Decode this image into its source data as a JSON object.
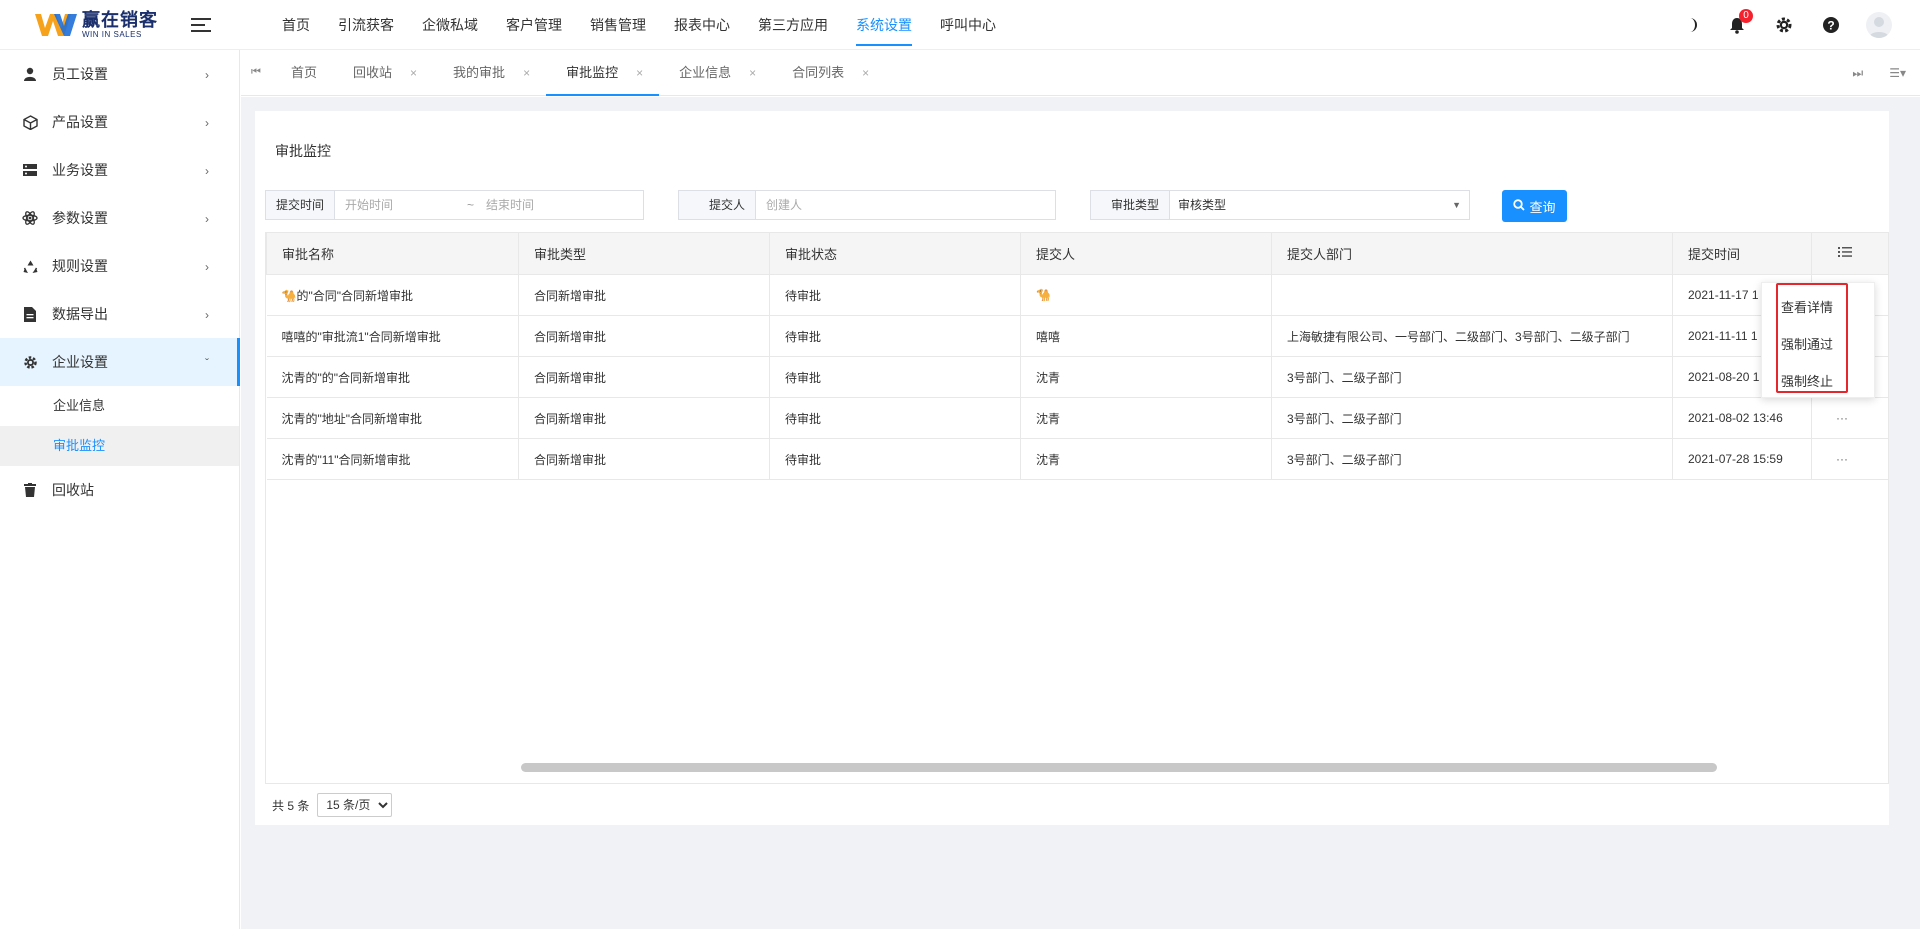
{
  "app": {
    "logo_cn": "赢在销客",
    "logo_en": "WIN IN SALES",
    "brand_color": "#1890ff"
  },
  "topnav": [
    {
      "label": "首页"
    },
    {
      "label": "引流获客"
    },
    {
      "label": "企微私域"
    },
    {
      "label": "客户管理"
    },
    {
      "label": "销售管理"
    },
    {
      "label": "报表中心"
    },
    {
      "label": "第三方应用"
    },
    {
      "label": "系统设置",
      "active": true
    },
    {
      "label": "呼叫中心"
    }
  ],
  "header_right": {
    "notification_count": "0",
    "icons": [
      "moon-icon",
      "bell-icon",
      "gear-icon",
      "help-icon",
      "avatar"
    ]
  },
  "sidebar": {
    "items": [
      {
        "label": "员工设置",
        "icon": "user-icon"
      },
      {
        "label": "产品设置",
        "icon": "box-icon"
      },
      {
        "label": "业务设置",
        "icon": "server-icon"
      },
      {
        "label": "参数设置",
        "icon": "atom-icon"
      },
      {
        "label": "规则设置",
        "icon": "recycle-icon"
      },
      {
        "label": "数据导出",
        "icon": "file-icon"
      },
      {
        "label": "企业设置",
        "icon": "gear-icon"
      },
      {
        "label": "回收站",
        "icon": "trash-icon"
      }
    ],
    "sub_items": [
      {
        "label": "企业信息"
      },
      {
        "label": "审批监控"
      }
    ]
  },
  "tabs": [
    {
      "label": "首页"
    },
    {
      "label": "回收站"
    },
    {
      "label": "我的审批"
    },
    {
      "label": "审批监控",
      "active": true
    },
    {
      "label": "企业信息"
    },
    {
      "label": "合同列表"
    }
  ],
  "tab_close_glyph": "×",
  "page": {
    "title": "审批监控"
  },
  "filters": {
    "submit_time_label": "提交时间",
    "start_placeholder": "开始时间",
    "range_sep": "~",
    "end_placeholder": "结束时间",
    "submitter_label": "提交人",
    "submitter_placeholder": "创建人",
    "type_label": "审批类型",
    "type_value": "审核类型",
    "search_label": "查询"
  },
  "table": {
    "columns": [
      "审批名称",
      "审批类型",
      "审批状态",
      "提交人",
      "提交人部门",
      "提交时间"
    ],
    "rows": [
      {
        "name": "🐪的\"合同\"合同新增审批",
        "type": "合同新增审批",
        "status": "待审批",
        "submitter": "🐪",
        "dept": "",
        "time": "2021-11-17 1",
        "ops": ""
      },
      {
        "name": "嘻嘻的\"审批流1\"合同新增审批",
        "type": "合同新增审批",
        "status": "待审批",
        "submitter": "嘻嘻",
        "dept": "上海敏捷有限公司、一号部门、二级部门、3号部门、二级子部门",
        "time": "2021-11-11 1",
        "ops": ""
      },
      {
        "name": "沈青的\"的\"合同新增审批",
        "type": "合同新增审批",
        "status": "待审批",
        "submitter": "沈青",
        "dept": "3号部门、二级子部门",
        "time": "2021-08-20 1",
        "ops": ""
      },
      {
        "name": "沈青的\"地址\"合同新增审批",
        "type": "合同新增审批",
        "status": "待审批",
        "submitter": "沈青",
        "dept": "3号部门、二级子部门",
        "time": "2021-08-02 13:46",
        "ops": "···"
      },
      {
        "name": "沈青的\"11\"合同新增审批",
        "type": "合同新增审批",
        "status": "待审批",
        "submitter": "沈青",
        "dept": "3号部门、二级子部门",
        "time": "2021-07-28 15:59",
        "ops": "···"
      }
    ]
  },
  "pager": {
    "total": "共 5 条",
    "page_size": "15 条/页"
  },
  "popup_menu": {
    "items": [
      "查看详情",
      "强制通过",
      "强制终止"
    ]
  }
}
